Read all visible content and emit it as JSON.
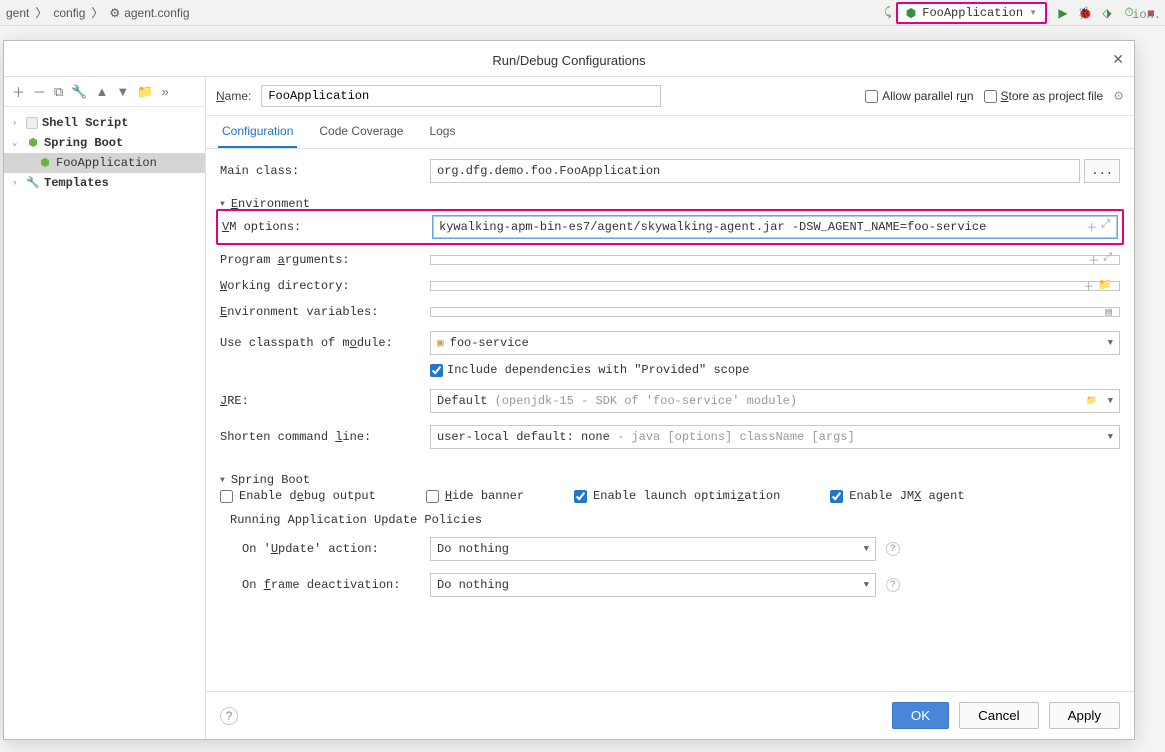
{
  "breadcrumb": {
    "p1": "gent",
    "p2": "config",
    "p3": "agent.config"
  },
  "run_combo": "FooApplication",
  "bg_text": "ion.",
  "dialog": {
    "title": "Run/Debug Configurations",
    "name_label": "Name:",
    "name_value": "FooApplication",
    "allow_parallel": "Allow parallel run",
    "store_project": "Store as project file",
    "tabs": {
      "config": "Configuration",
      "coverage": "Code Coverage",
      "logs": "Logs"
    },
    "main_class_label": "Main class:",
    "main_class_value": "org.dfg.demo.foo.FooApplication",
    "environment_header": "Environment",
    "vm_label": "VM options:",
    "vm_value": "kywalking-apm-bin-es7/agent/skywalking-agent.jar -DSW_AGENT_NAME=foo-service",
    "prog_args_label": "Program arguments:",
    "working_dir_label": "Working directory:",
    "env_vars_label": "Environment variables:",
    "classpath_label": "Use classpath of module:",
    "classpath_value": "foo-service",
    "include_provided": "Include dependencies with \"Provided\" scope",
    "jre_label": "JRE:",
    "jre_value": "Default",
    "jre_hint": "(openjdk-15 - SDK of 'foo-service' module)",
    "shorten_label": "Shorten command line:",
    "shorten_value": "user-local default: none",
    "shorten_hint": "- java [options] className [args]",
    "spring_boot_header": "Spring Boot",
    "debug_output": "Enable debug output",
    "hide_banner": "Hide banner",
    "launch_opt": "Enable launch optimization",
    "jmx_agent": "Enable JMX agent",
    "update_policies_header": "Running Application Update Policies",
    "on_update_label": "On 'Update' action:",
    "on_update_value": "Do nothing",
    "on_frame_label": "On frame deactivation:",
    "on_frame_value": "Do nothing",
    "ok": "OK",
    "cancel": "Cancel",
    "apply": "Apply"
  },
  "tree": {
    "shell_script": "Shell Script",
    "spring_boot": "Spring Boot",
    "foo_app": "FooApplication",
    "templates": "Templates"
  }
}
